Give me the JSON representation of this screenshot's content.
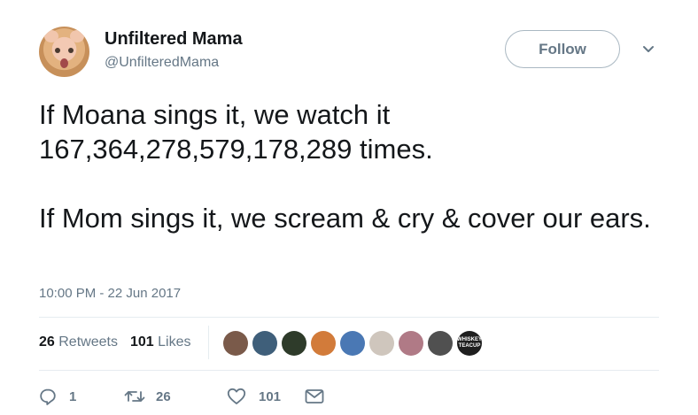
{
  "author": {
    "name": "Unfiltered Mama",
    "handle": "@UnfilteredMama"
  },
  "follow_label": "Follow",
  "tweet": {
    "line1": "If Moana sings it, we watch it 167,364,278,579,178,289 times.",
    "line2": "If Mom sings it, we scream & cry & cover our ears."
  },
  "timestamp": "10:00 PM - 22 Jun 2017",
  "stats": {
    "retweets_count": "26",
    "retweets_label": "Retweets",
    "likes_count": "101",
    "likes_label": "Likes"
  },
  "likers": [
    {
      "color": "#7a5a4a"
    },
    {
      "color": "#3f5f7a"
    },
    {
      "color": "#2e3b2a"
    },
    {
      "color": "#d27b3a"
    },
    {
      "color": "#4a78b4"
    },
    {
      "color": "#cfc6bd"
    },
    {
      "color": "#b07a86"
    },
    {
      "color": "#505050"
    },
    {
      "color": "#1f1f1f",
      "badge": "WHISKEY TEACUP"
    }
  ],
  "actions": {
    "reply_count": "1",
    "retweet_count": "26",
    "like_count": "101"
  },
  "colors": {
    "text": "#14171a",
    "secondary": "#657786",
    "border": "#e6ecf0"
  },
  "icons": [
    "reply-icon",
    "retweet-icon",
    "heart-icon",
    "message-icon",
    "chevron-down-icon"
  ]
}
